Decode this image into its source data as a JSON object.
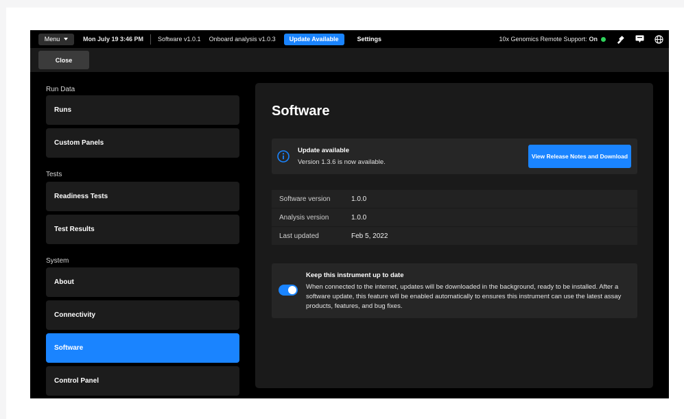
{
  "topbar": {
    "menu_label": "Menu",
    "datetime": "Mon July 19  3:46 PM",
    "software_version": "Software v1.0.1",
    "analysis_version": "Onboard analysis v1.0.3",
    "update_badge": "Update Available",
    "settings_label": "Settings",
    "remote_support_label": "10x Genomics Remote Support:",
    "remote_support_status": "On",
    "status_color": "#2fd35b"
  },
  "subbar": {
    "close_label": "Close"
  },
  "sidebar": {
    "sections": [
      {
        "label": "Run Data"
      },
      {
        "label": "Tests"
      },
      {
        "label": "System"
      }
    ],
    "items": [
      {
        "label": "Runs"
      },
      {
        "label": "Custom Panels"
      },
      {
        "label": "Readiness Tests"
      },
      {
        "label": "Test Results"
      },
      {
        "label": "About"
      },
      {
        "label": "Connectivity"
      },
      {
        "label": "Software",
        "active": true
      },
      {
        "label": "Control Panel"
      }
    ]
  },
  "main": {
    "title": "Software",
    "banner": {
      "title": "Update available",
      "message": "Version 1.3.6 is now available.",
      "button_label": "View Release Notes and Download"
    },
    "info_rows": [
      {
        "key": "Software version",
        "value": "1.0.0"
      },
      {
        "key": "Analysis version",
        "value": "1.0.0"
      },
      {
        "key": "Last updated",
        "value": "Feb 5, 2022"
      }
    ],
    "auto_update": {
      "title": "Keep this instrument up to date",
      "description": "When connected to the internet, updates will be downloaded in the background, ready to be installed. After a software update, this feature will be enabled automatically to ensures this instrument can use the latest assay products, features, and bug fixes.",
      "enabled": true
    }
  },
  "colors": {
    "accent": "#1a84ff",
    "background": "#000000",
    "card": "#1c1c1c"
  }
}
